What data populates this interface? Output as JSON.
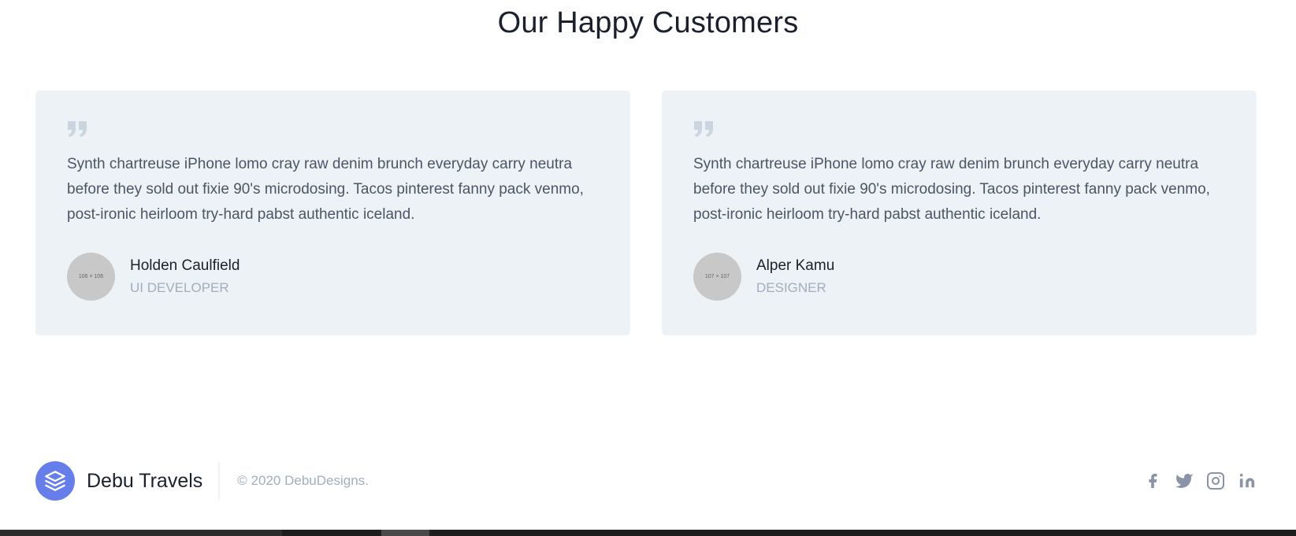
{
  "section": {
    "title": "Our Happy Customers"
  },
  "testimonials": [
    {
      "quote": "Synth chartreuse iPhone lomo cray raw denim brunch everyday carry neutra before they sold out fixie 90's microdosing. Tacos pinterest fanny pack venmo, post-ironic heirloom try-hard pabst authentic iceland.",
      "avatar_label": "106 × 106",
      "name": "Holden Caulfield",
      "role": "UI DEVELOPER"
    },
    {
      "quote": "Synth chartreuse iPhone lomo cray raw denim brunch everyday carry neutra before they sold out fixie 90's microdosing. Tacos pinterest fanny pack venmo, post-ironic heirloom try-hard pabst authentic iceland.",
      "avatar_label": "107 × 107",
      "name": "Alper Kamu",
      "role": "DESIGNER"
    }
  ],
  "footer": {
    "brand": "Debu Travels",
    "copyright": "© 2020 DebuDesigns.",
    "social_icons": [
      "facebook-icon",
      "twitter-icon",
      "instagram-icon",
      "linkedin-icon"
    ]
  },
  "colors": {
    "accent": "#667eea",
    "card_bg": "#edf2f7",
    "muted": "#a0aec0",
    "icon": "#8a94a6"
  }
}
